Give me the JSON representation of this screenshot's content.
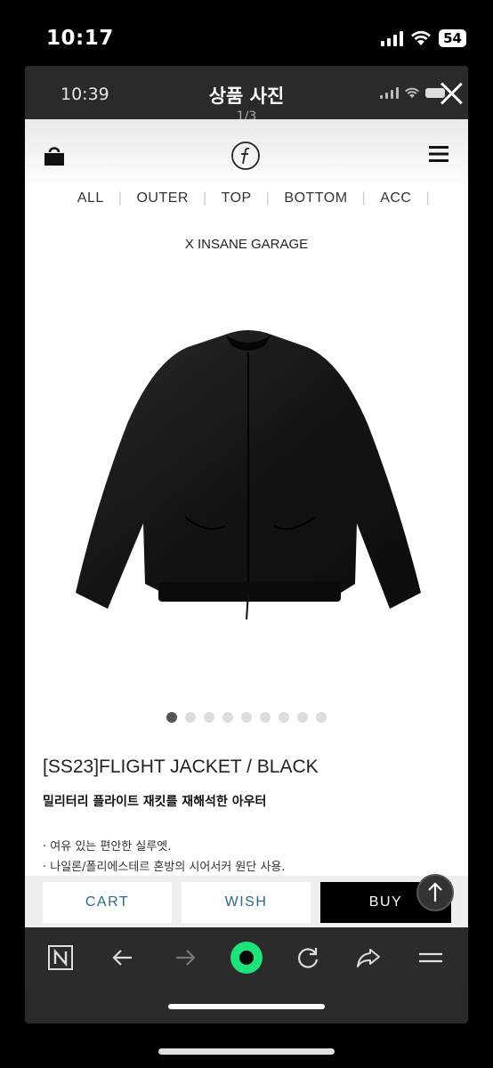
{
  "outer_status": {
    "time": "10:17",
    "battery": "54"
  },
  "viewer": {
    "time": "10:39",
    "title": "상품 사진",
    "pager": "1/3"
  },
  "site": {
    "nav": [
      "ALL",
      "OUTER",
      "TOP",
      "BOTTOM",
      "ACC"
    ],
    "collab": "X INSANE GARAGE",
    "icons": {
      "cart": "shopping-bag-icon",
      "logo": "brand-logo-icon",
      "menu": "hamburger-menu-icon"
    }
  },
  "product": {
    "title": "[SS23]FLIGHT JACKET / BLACK",
    "subtitle": "밀리터리 플라이트 재킷를 재해석한 아우터",
    "desc": [
      "· 여유 있는 편안한 실루엣.",
      "· 나일론/폴리에스테르 혼방의 시어서커 원단 사용."
    ],
    "image_dots": 9,
    "active_dot": 0
  },
  "buy_bar": {
    "cart": "CART",
    "wish": "WISH",
    "buy": "BUY"
  },
  "browser_bar": [
    "naver-n-icon",
    "back-arrow-icon",
    "forward-arrow-icon",
    "green-home-icon",
    "refresh-icon",
    "share-icon",
    "menu-icon"
  ]
}
